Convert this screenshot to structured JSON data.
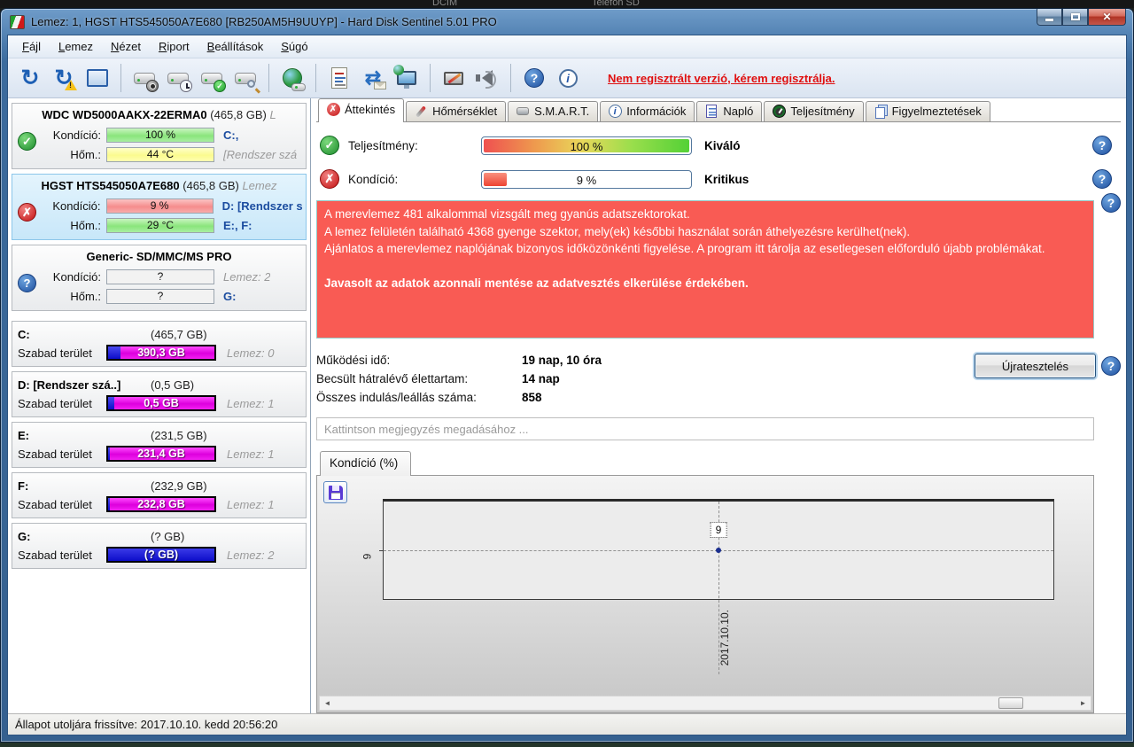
{
  "desktop": {
    "fragment1": "DCIM",
    "fragment2": "Telefon SD"
  },
  "window": {
    "title": "Lemez: 1, HGST HTS545050A7E680 [RB250AM5H9UUYP]  -  Hard Disk Sentinel 5.01 PRO"
  },
  "menu": {
    "items": [
      {
        "label": "Fájl"
      },
      {
        "label": "Lemez"
      },
      {
        "label": "Nézet"
      },
      {
        "label": "Riport"
      },
      {
        "label": "Beállítások"
      },
      {
        "label": "Súgó"
      }
    ]
  },
  "toolbar": {
    "registration_text": "Nem regisztrált verzió, kérem regisztrálja.",
    "icons": [
      "refresh",
      "refresh-warning",
      "disk-view",
      "disk-sound",
      "disk-clock",
      "disk-check",
      "disk-search",
      "network-disk",
      "report",
      "sync-mail",
      "remote-monitor",
      "system-tools",
      "sound",
      "help",
      "info"
    ]
  },
  "tabs": [
    {
      "label": "Áttekintés"
    },
    {
      "label": "Hőmérséklet"
    },
    {
      "label": "S.M.A.R.T."
    },
    {
      "label": "Információk"
    },
    {
      "label": "Napló"
    },
    {
      "label": "Teljesítmény"
    },
    {
      "label": "Figyelmeztetések"
    }
  ],
  "sidebar": {
    "labels": {
      "condition": "Kondíció:",
      "temperature": "Hőm.:",
      "free_space": "Szabad terület"
    },
    "disks": [
      {
        "name": "WDC WD5000AAKX-22ERMA0",
        "size": "(465,8 GB)",
        "tail": "L",
        "condition": "100 %",
        "condition_right": "C:,",
        "temperature": "44 °C",
        "temperature_right": "[Rendszer szá"
      },
      {
        "name": "HGST HTS545050A7E680",
        "size": "(465,8 GB)",
        "tail": "Lemez",
        "condition": "9 %",
        "condition_right": "D: [Rendszer s",
        "temperature": "29 °C",
        "temperature_right": "E:, F:"
      },
      {
        "name": "Generic- SD/MMC/MS PRO",
        "size": "",
        "tail": "",
        "condition": "?",
        "condition_right": "Lemez: 2",
        "temperature": "?",
        "temperature_right": "G:"
      }
    ],
    "partitions": [
      {
        "letter": "C:",
        "size": "(465,7 GB)",
        "free": "390,3 GB",
        "disk": "Lemez: 0"
      },
      {
        "letter": "D: [Rendszer szá..]",
        "size": "(0,5 GB)",
        "free": "0,5 GB",
        "disk": "Lemez: 1"
      },
      {
        "letter": "E:",
        "size": "(231,5 GB)",
        "free": "231,4 GB",
        "disk": "Lemez: 1"
      },
      {
        "letter": "F:",
        "size": "(232,9 GB)",
        "free": "232,8 GB",
        "disk": "Lemez: 1"
      },
      {
        "letter": "G:",
        "size": "(? GB)",
        "free": "(? GB)",
        "disk": "Lemez: 2"
      }
    ]
  },
  "overview": {
    "performance": {
      "label": "Teljesítmény:",
      "value": "100 %",
      "rating": "Kiváló"
    },
    "condition": {
      "label": "Kondíció:",
      "value": "9 %",
      "rating": "Kritikus"
    },
    "warning": {
      "line1": "A merevlemez 481 alkalommal vizsgált meg gyanús adatszektorokat.",
      "line2": "A lemez felületén található 4368 gyenge szektor, mely(ek) későbbi használat során áthelyezésre kerülhet(nek).",
      "line3": "Ajánlatos a merevlemez naplójának bizonyos időközönkénti figyelése. A program itt tárolja az esetlegesen előforduló újabb problémákat.",
      "advice": "Javasolt az adatok azonnali mentése az adatvesztés elkerülése érdekében."
    },
    "stats": [
      {
        "label": "Működési idő:",
        "value": "19 nap, 10 óra"
      },
      {
        "label": "Becsült hátralévő élettartam:",
        "value": "14 nap"
      },
      {
        "label": "Összes indulás/leállás száma:",
        "value": "858"
      }
    ],
    "retest_button": "Újratesztelés",
    "comment_placeholder": "Kattintson megjegyzés megadásához ..."
  },
  "chart_data": {
    "type": "line",
    "title": "Kondíció  (%)",
    "x_labels": [
      "2017.10.10."
    ],
    "series": [
      {
        "name": "Kondíció",
        "values": [
          9
        ]
      }
    ],
    "point_label": "9",
    "ytick_labels": [
      "9"
    ],
    "grid": "dashed-crosshair",
    "legend": "none"
  },
  "statusbar": {
    "text": "Állapot utoljára frissítve: 2017.10.10. kedd 20:56:20"
  },
  "colors": {
    "warning_bg": "#f95b54",
    "free_magenta": "#dd00dd",
    "used_blue": "#0d0dc9",
    "cond_green": "#8ae57c",
    "temp_yellow": "#fbfb8e",
    "cond_red": "#f58d8d",
    "registration_red": "#e01010",
    "selected_entry": "#c8e7f9"
  }
}
